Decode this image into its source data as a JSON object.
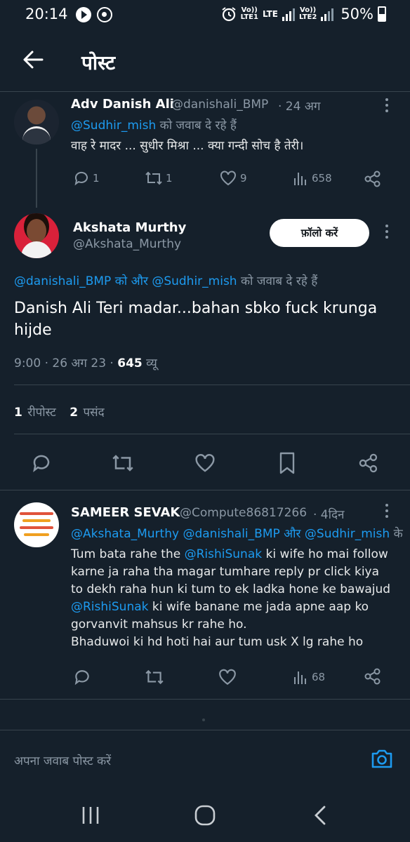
{
  "status_bar": {
    "time": "20:14",
    "lte1_top": "Vo))",
    "lte1_bottom": "LTE1",
    "lte_label": "LTE",
    "lte2_top": "Vo))",
    "lte2_bottom": "LTE2",
    "battery": "50%"
  },
  "header": {
    "title": "पोस्ट"
  },
  "parent_post": {
    "name": "Adv Danish Ali",
    "handle": "@danishali_BMP",
    "time": "· 24 अग",
    "reply_mention": "@Sudhir_mish",
    "reply_suffix": " को जवाब दे रहे हैं",
    "text": "वाह रे मादर ... सुधीर मिश्रा ... क्या गन्दी सोच है तेरी।",
    "replies": "1",
    "reposts": "1",
    "likes": "9",
    "views": "658"
  },
  "main_post": {
    "name": "Akshata Murthy",
    "handle": "@Akshata_Murthy",
    "follow_label": "फ़ॉलो करें",
    "reply_mention_1": "@danishali_BMP",
    "reply_and": " को और ",
    "reply_mention_2": "@Sudhir_mish",
    "reply_suffix": " को जवाब दे रहे हैं",
    "text_line_1": "Danish Ali Teri madar...bahan sbko fuck krunga",
    "text_line_2": "hijde",
    "meta_time": "9:00 · 26 अग 23 · ",
    "views_count": "645",
    "views_label": " व्यू",
    "reposts_count": "1",
    "reposts_label": "रीपोस्ट",
    "likes_count": "2",
    "likes_label": "पसंद"
  },
  "reply_post": {
    "name": "SAMEER SEVAK",
    "handle": "@Compute86817266",
    "time": "· 4दिन",
    "mention_1": "@Akshata_Murthy",
    "mention_2": "@danishali_BMP",
    "and_text": " और ",
    "mention_3": "@Sudhir_mish",
    "suffix": " के",
    "line1_a": "Tum bata rahe the ",
    "line1_mention": "@RishiSunak",
    "line1_b": " ki wife ho mai follow",
    "line2": "karne ja raha tha magar tumhare reply pr click kiya",
    "line3": "to dekh raha hun ki tum to ek ladka hone ke bawajud",
    "line4_mention": "@RishiSunak",
    "line4_b": " ki wife banane me jada apne aap ko",
    "line5": "gorvanvit mahsus kr rahe ho.",
    "line6": "Bhaduwoi ki hd hoti hai aur tum usk X lg rahe ho",
    "views": "68"
  },
  "reply_bar": {
    "placeholder": "अपना जवाब पोस्ट करें"
  },
  "colors": {
    "background": "#15202b",
    "accent": "#1d9bf0",
    "muted": "#8b98a5",
    "divider": "#38444d"
  },
  "icons": [
    "back-arrow-icon",
    "reply-icon",
    "repost-icon",
    "like-icon",
    "views-icon",
    "share-icon",
    "bookmark-icon",
    "camera-icon",
    "more-icon"
  ]
}
